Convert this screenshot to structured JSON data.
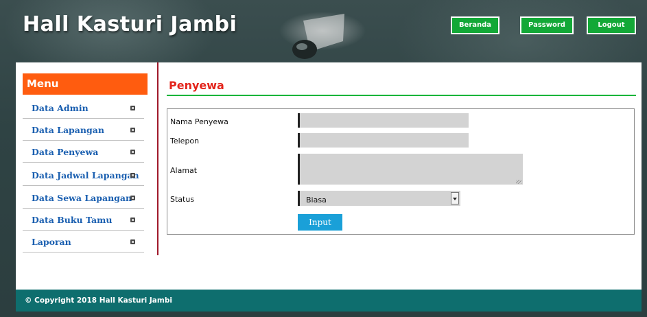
{
  "header": {
    "brand": "Hall Kasturi Jambi",
    "nav": {
      "beranda": "Beranda",
      "password": "Password",
      "logout": "Logout"
    },
    "nav_color": "#13a837"
  },
  "sidebar": {
    "title": "Menu",
    "title_color": "#ff5c0f",
    "items": [
      {
        "label": "Data Admin"
      },
      {
        "label": "Data Lapangan"
      },
      {
        "label": "Data Penyewa"
      },
      {
        "label": "Data Jadwal Lapangan"
      },
      {
        "label": "Data Sewa Lapangan"
      },
      {
        "label": "Data Buku Tamu"
      },
      {
        "label": "Laporan"
      }
    ]
  },
  "main": {
    "title": "Penyewa",
    "form": {
      "nama_label": "Nama Penyewa",
      "nama_value": "",
      "telepon_label": "Telepon",
      "telepon_value": "",
      "alamat_label": "Alamat",
      "alamat_value": "",
      "status_label": "Status",
      "status_value": "Biasa",
      "submit_label": "Input"
    }
  },
  "footer": {
    "text": "© Copyright 2018 Hall Kasturi Jambi"
  }
}
